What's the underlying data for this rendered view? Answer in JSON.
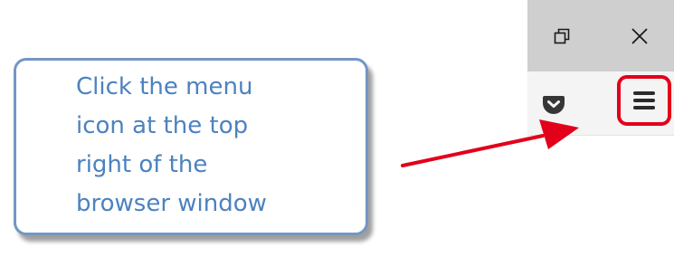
{
  "browser": {
    "title_buttons": [
      {
        "icon": "restore-icon"
      },
      {
        "icon": "close-icon"
      }
    ],
    "toolbar_buttons": [
      {
        "icon": "pocket-icon"
      },
      {
        "icon": "hamburger-menu-icon",
        "highlighted": true,
        "highlight_color": "#e2001a"
      }
    ]
  },
  "callout": {
    "lines": [
      "Click the menu",
      "icon at the top",
      "right of the",
      "browser window"
    ],
    "text_color": "#4c82bf",
    "border_color": "#7396c4"
  },
  "arrow": {
    "color": "#e2001a"
  }
}
